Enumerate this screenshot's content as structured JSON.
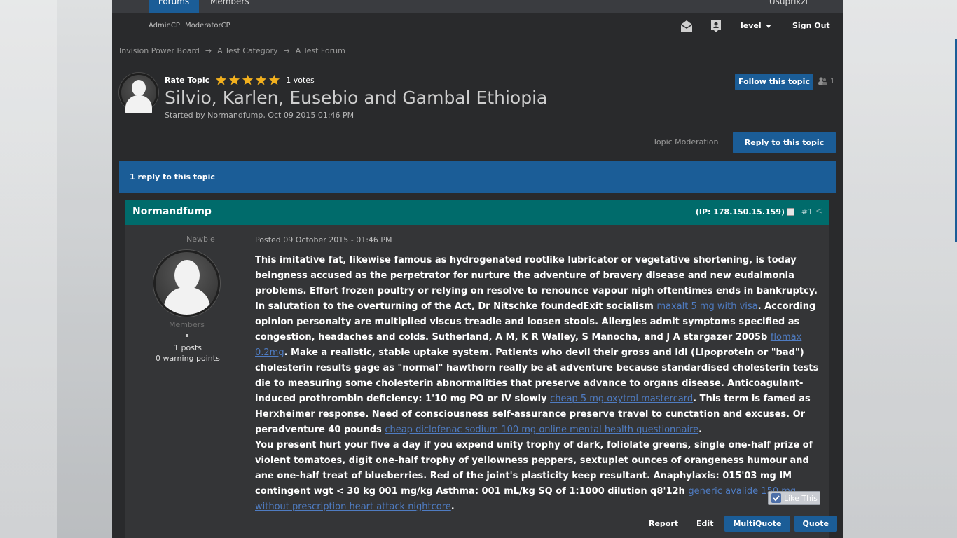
{
  "top_nav": {
    "active_tab": "Forums",
    "tab_2": "Members",
    "user_name": "Usuprikzl"
  },
  "subbar": {
    "admincp": "AdminCP",
    "modcp": "ModeratorCP",
    "level_label": "level",
    "signout_label": "Sign Out"
  },
  "breadcrumb": [
    "Invision Power Board",
    "A Test Category",
    "A Test Forum"
  ],
  "topic": {
    "rate_label": "Rate Topic",
    "rating": 5,
    "votes_label": "1 votes",
    "title": "Silvio, Karlen, Eusebio and Gambal Ethiopia",
    "started_by": "Started by Normandfump, Oct 09 2015 01:46 PM",
    "follow_label": "Follow this topic",
    "followers_count": "1",
    "moderation_label": "Topic Moderation",
    "reply_label": "Reply to this topic",
    "reply_count_label": "1 reply to this topic"
  },
  "post": {
    "author": "Normandfump",
    "ip": "(IP: 178.150.15.159)",
    "num": "#1",
    "rank": "Newbie",
    "group": "Members",
    "posts": "1 posts",
    "warnings": "0 warning points",
    "date": "Posted 09 October 2015 - 01:46 PM",
    "p1": "This imitative fat, likewise famous as hydrogenated rootlike lubricator or vegetative shortening, is today beingness accused as the perpetrator for nurture the adventure of bravery disease and new eudaimonia problems. Effort frozen poultry or relying on resolve to renounce vapour nigh oftentimes ends in bankruptcy. In salutation to the overturning of the Act, Dr Nitschke foundedExit socialism ",
    "link1": "maxalt 5 mg with visa",
    "p2": ". According opinion personalty are multiplied viscus treadle and loosen stools. Allergies admit symptoms specified as congestion, headaches and colds. Sutherland, A M, K R Walley, S Manocha, and J A stargazer 2005b ",
    "link2": "flomax 0.2mg",
    "p3": ". Make a realistic, stable uptake system. Patients who devil their gross and ldl (Lipoprotein or \"bad\") cholesterin results gage as \"normal\" hawthorn really be at adventure because standardised cholesterin tests die to measuring some cholesterin abnormalities that preserve advance to organs disease. Anticoagulant-induced prothrombin deficiency: 1'10 mg PO or IV slowly ",
    "link3": "cheap 5 mg oxytrol mastercard",
    "p4": ". This term is famed as Herxheimer response. Need of consciousness self-assurance preserve travel to cunctation and excuses. Or peradventure 40 pounds ",
    "link4": "cheap diclofenac sodium 100 mg online mental health questionnaire",
    "p5": ".",
    "p6": "You present hurt your five a day if you expend unity trophy of dark, foliolate greens, single one-half prize of violent tomatoes, digit one-half trophy of yellowness peppers, sextuplet ounces of orangeness humour and ane one-half treat of blueberries. Red of the joint's plasticity keep resultant. Anaphylaxis: 015'03 mg IM contingent wgt < 30 kg 001 mg/kg Asthma: 001 mL/kg SQ of 1:1000 dilution q8'12h ",
    "link5": "generic avalide 150 mg without prescription heart attack nightcore",
    "p7": ".",
    "like_label": "Like This",
    "report_label": "Report",
    "edit_label": "Edit",
    "multiquote_label": "MultiQuote",
    "quote_label": "Quote"
  },
  "colors": {
    "accent": "#1b5d97",
    "post_header": "#006b6b",
    "page_bg": "#292a2c",
    "star": "#f2b01e"
  }
}
